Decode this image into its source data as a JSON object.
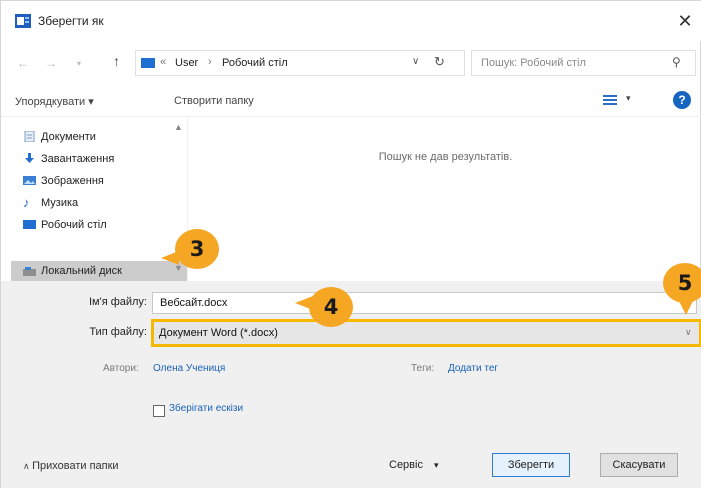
{
  "window": {
    "title": "Зберегти як",
    "close_label": "✕"
  },
  "address": {
    "separator": "«",
    "path": [
      "User",
      "Робочий стіл"
    ],
    "chevron": "›",
    "search_placeholder": "Пошук: Робочий стіл"
  },
  "toolbar": {
    "organize": "Упорядкувати ▾",
    "new_folder": "Створити папку",
    "help": "?"
  },
  "sidebar": {
    "items": [
      {
        "label": "Документи",
        "icon": "document-icon"
      },
      {
        "label": "Завантаження",
        "icon": "download-icon"
      },
      {
        "label": "Зображення",
        "icon": "image-icon"
      },
      {
        "label": "Музика",
        "icon": "music-icon"
      },
      {
        "label": "Робочий стіл",
        "icon": "desktop-icon"
      },
      {
        "label": "Локальний диск",
        "icon": "drive-icon"
      }
    ]
  },
  "content": {
    "empty_message": "Пошук не дав результатів."
  },
  "form": {
    "filename_label": "Ім'я файлу:",
    "filename_value": "Вебсайт.docx",
    "filetype_label": "Тип файлу:",
    "filetype_value": "Документ Word (*.docx)",
    "authors_label": "Автори:",
    "authors_value": "Олена Учениця",
    "tags_label": "Теги:",
    "tags_value": "Додати тег",
    "thumbnail_label": "Зберігати ескізи"
  },
  "footer": {
    "hide_folders": "Приховати папки",
    "tools": "Сервіс",
    "save": "Зберегти",
    "cancel": "Скасувати"
  },
  "callouts": [
    "3",
    "4",
    "5"
  ],
  "colors": {
    "callout": "#f5a623",
    "highlight_border": "#f5b700",
    "accent": "#1565c0"
  }
}
